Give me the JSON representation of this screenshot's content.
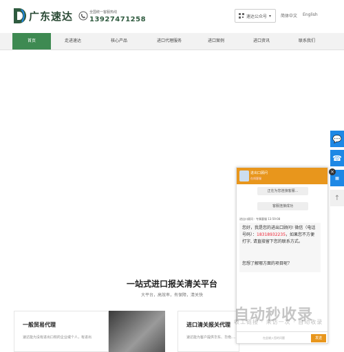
{
  "header": {
    "brand": "广东速达",
    "phone_label": "全国统一客服热线",
    "phone_number": "13927471258",
    "wechat_label": "速达公众号",
    "lang_cn": "简体中文",
    "lang_en": "English"
  },
  "nav": {
    "items": [
      {
        "label": "首页"
      },
      {
        "label": "走进速达"
      },
      {
        "label": "核心产品"
      },
      {
        "label": "进口代理服务"
      },
      {
        "label": "进口案例"
      },
      {
        "label": "进口资讯"
      },
      {
        "label": "联系我们"
      }
    ]
  },
  "section": {
    "title": "一站式进口报关清关平台",
    "subtitle": "大平台，高效率，有保障，清关快"
  },
  "cards": [
    {
      "title": "一般贸易代理",
      "text": "速达能为没有进出口权的企业或个人，有进出"
    },
    {
      "title": "进口清关报关代理",
      "text": "速达能为客户提供华东、华南……"
    }
  ],
  "chat": {
    "agent_name": "进出口顾问",
    "agent_status": "在线客服",
    "pill1": "正在为您连接客服...",
    "pill2": "客服连接成功",
    "meta": "进出口顾问 - 专属客服  13:59:08",
    "msg_intro": "您好，我是您的进出口顾问! 微信（电话号码）：",
    "msg_number": "18318932235",
    "msg_rest": "，如果您不方便打字, 请直接留下您的联系方式。",
    "question": "您想了解哪方面的项目呢？",
    "input_placeholder": "在此输入您的问题",
    "send_label": "发送"
  },
  "watermark": {
    "main": "自动秒收录",
    "sub": "收工链接 · 来访一次 · 自动收录"
  },
  "colors": {
    "accent": "#3e8a52",
    "chat": "#e8961c",
    "side": "#1e88e5"
  }
}
